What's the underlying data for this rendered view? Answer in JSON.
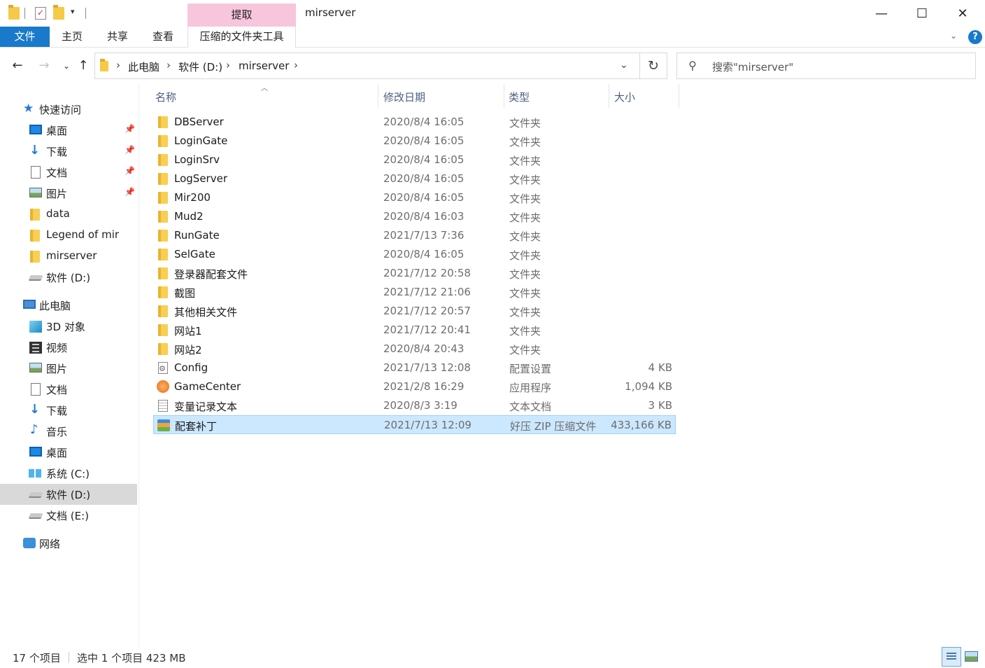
{
  "window": {
    "title": "mirserver",
    "context_tab_header": "提取",
    "minimize": "—",
    "maximize": "☐",
    "close": "✕"
  },
  "ribbon": {
    "tabs": [
      "文件",
      "主页",
      "共享",
      "查看",
      "压缩的文件夹工具"
    ],
    "help": "?"
  },
  "address": {
    "crumbs": [
      "此电脑",
      "软件 (D:)",
      "mirserver"
    ],
    "search_placeholder": "搜索\"mirserver\""
  },
  "nav": {
    "quick_access": "快速访问",
    "quick_items": [
      "桌面",
      "下载",
      "文档",
      "图片",
      "data",
      "Legend of mir",
      "mirserver",
      "软件 (D:)"
    ],
    "this_pc": "此电脑",
    "pc_items": [
      "3D 对象",
      "视频",
      "图片",
      "文档",
      "下载",
      "音乐",
      "桌面",
      "系统 (C:)",
      "软件 (D:)",
      "文档 (E:)"
    ],
    "network": "网络",
    "selected": "软件 (D:)"
  },
  "columns": {
    "name": "名称",
    "modified": "修改日期",
    "type": "类型",
    "size": "大小"
  },
  "files": [
    {
      "name": "DBServer",
      "date": "2020/8/4 16:05",
      "type": "文件夹",
      "size": "",
      "icon": "folder-icon"
    },
    {
      "name": "LoginGate",
      "date": "2020/8/4 16:05",
      "type": "文件夹",
      "size": "",
      "icon": "folder-icon"
    },
    {
      "name": "LoginSrv",
      "date": "2020/8/4 16:05",
      "type": "文件夹",
      "size": "",
      "icon": "folder-icon"
    },
    {
      "name": "LogServer",
      "date": "2020/8/4 16:05",
      "type": "文件夹",
      "size": "",
      "icon": "folder-icon"
    },
    {
      "name": "Mir200",
      "date": "2020/8/4 16:05",
      "type": "文件夹",
      "size": "",
      "icon": "folder-icon"
    },
    {
      "name": "Mud2",
      "date": "2020/8/4 16:03",
      "type": "文件夹",
      "size": "",
      "icon": "folder-icon"
    },
    {
      "name": "RunGate",
      "date": "2021/7/13 7:36",
      "type": "文件夹",
      "size": "",
      "icon": "folder-icon"
    },
    {
      "name": "SelGate",
      "date": "2020/8/4 16:05",
      "type": "文件夹",
      "size": "",
      "icon": "folder-icon"
    },
    {
      "name": "登录器配套文件",
      "date": "2021/7/12 20:58",
      "type": "文件夹",
      "size": "",
      "icon": "folder-icon"
    },
    {
      "name": "截图",
      "date": "2021/7/12 21:06",
      "type": "文件夹",
      "size": "",
      "icon": "folder-icon"
    },
    {
      "name": "其他相关文件",
      "date": "2021/7/12 20:57",
      "type": "文件夹",
      "size": "",
      "icon": "folder-icon"
    },
    {
      "name": "网站1",
      "date": "2021/7/12 20:41",
      "type": "文件夹",
      "size": "",
      "icon": "folder-icon"
    },
    {
      "name": "网站2",
      "date": "2020/8/4 20:43",
      "type": "文件夹",
      "size": "",
      "icon": "folder-icon"
    },
    {
      "name": "Config",
      "date": "2021/7/13 12:08",
      "type": "配置设置",
      "size": "4 KB",
      "icon": "config-file-icon"
    },
    {
      "name": "GameCenter",
      "date": "2021/2/8 16:29",
      "type": "应用程序",
      "size": "1,094 KB",
      "icon": "application-icon"
    },
    {
      "name": "变量记录文本",
      "date": "2020/8/3 3:19",
      "type": "文本文档",
      "size": "3 KB",
      "icon": "text-file-icon"
    },
    {
      "name": "配套补丁",
      "date": "2021/7/13 12:09",
      "type": "好压 ZIP 压缩文件",
      "size": "433,166 KB",
      "icon": "zip-archive-icon"
    }
  ],
  "selected_file": "配套补丁",
  "status": {
    "count": "17 个项目",
    "selection": "选中 1 个项目  423 MB"
  },
  "colors": {
    "accent": "#1979ca",
    "context_tab": "#f7c6dc",
    "selection": "#cce8ff"
  }
}
